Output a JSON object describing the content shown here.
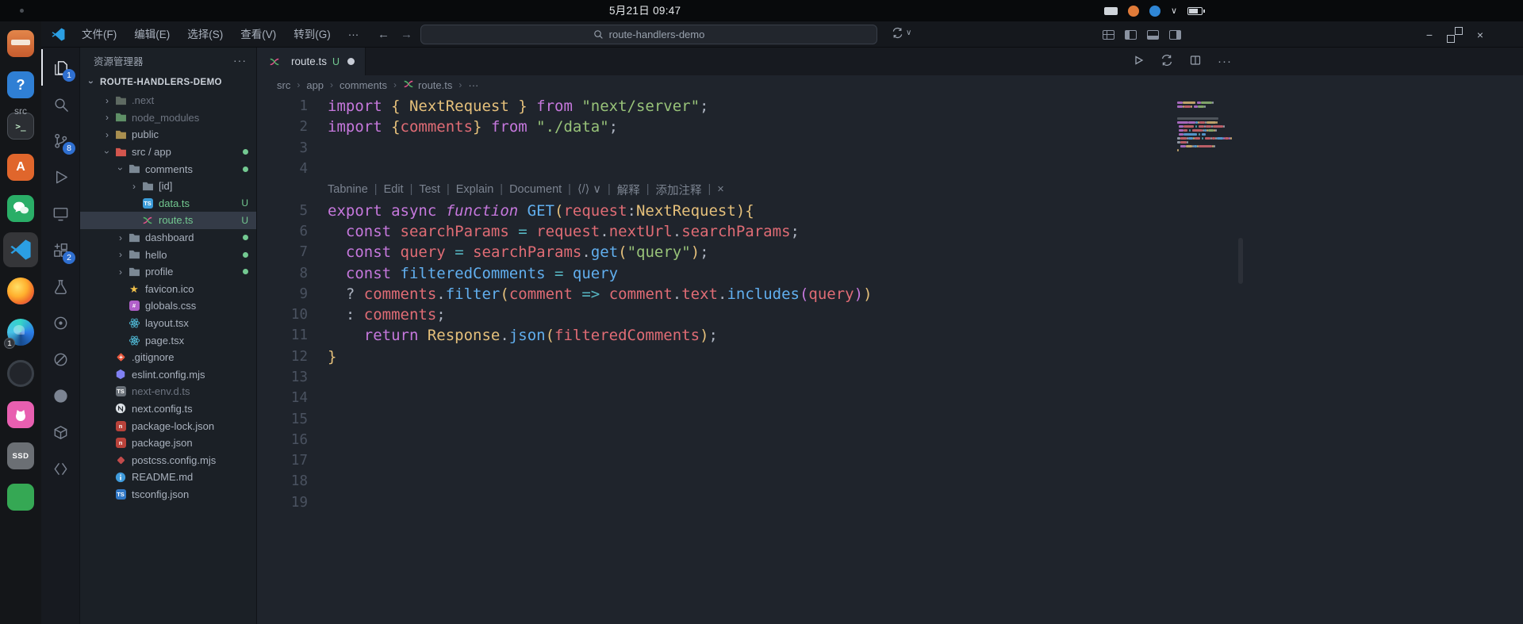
{
  "colors": {
    "tokens": {
      "kw": "#c678dd",
      "kwi": "#c678dd",
      "fn": "#61afef",
      "var": "#e06c75",
      "cls": "#e5c07b",
      "str": "#98c379",
      "op": "#56b6c2",
      "d": "#abb2bf",
      "br2": "#c678dd"
    },
    "accent": "#2f6fd0",
    "git_green": "#73c991"
  },
  "system_bar": {
    "clock": "5月21日 09:47",
    "tray": [
      {
        "name": "keyboard-icon",
        "kind": "keyboard"
      },
      {
        "name": "input-indicator-orange",
        "kind": "orange"
      },
      {
        "name": "app-indicator-blue",
        "kind": "blue"
      },
      {
        "name": "chevron-down-icon",
        "kind": "glyph",
        "glyph": "∨"
      },
      {
        "name": "battery-icon",
        "kind": "battery"
      }
    ]
  },
  "dock": {
    "desktop_label": "src",
    "items": [
      {
        "name": "files-app",
        "icon": "toolbox"
      },
      {
        "name": "help-app",
        "icon": "help",
        "glyph": "?"
      },
      {
        "name": "terminal-app",
        "icon": "terminal",
        "glyph": ">_"
      },
      {
        "name": "app-center",
        "icon": "appcenter",
        "glyph": "A"
      },
      {
        "name": "wechat-app",
        "icon": "wechat"
      },
      {
        "name": "vscode-app",
        "icon": "vscode",
        "active": true
      },
      {
        "name": "firefox-app",
        "icon": "firefox"
      },
      {
        "name": "edge-app",
        "icon": "edge",
        "badge": "1"
      },
      {
        "name": "dark-app",
        "icon": "darkapp"
      },
      {
        "name": "cat-app",
        "icon": "cat"
      },
      {
        "name": "ssd-disk",
        "icon": "ssd",
        "glyph": "SSD"
      },
      {
        "name": "green-app",
        "icon": "green"
      }
    ]
  },
  "titlebar": {
    "menus": [
      "文件(F)",
      "编辑(E)",
      "选择(S)",
      "查看(V)",
      "转到(G)",
      "···"
    ],
    "nav_back": "←",
    "nav_forward": "→",
    "search_value": "route-handlers-demo",
    "layout_icons": [
      {
        "name": "customize-layout-icon",
        "k": "grid"
      },
      {
        "name": "toggle-sidebar-icon",
        "k": "left"
      },
      {
        "name": "toggle-panel-icon",
        "k": "bottom"
      },
      {
        "name": "toggle-secondary-sidebar-icon",
        "k": "right"
      }
    ],
    "window_controls": [
      {
        "name": "minimize-button",
        "glyph": "−"
      },
      {
        "name": "restore-button",
        "kind": "restore"
      },
      {
        "name": "close-button",
        "glyph": "×"
      }
    ]
  },
  "activity_bar": {
    "items": [
      {
        "name": "explorer",
        "icon": "files",
        "badge": "1",
        "active": true
      },
      {
        "name": "search",
        "icon": "search"
      },
      {
        "name": "source-control",
        "icon": "scm",
        "badge": "8"
      },
      {
        "name": "run-and-debug",
        "icon": "debug"
      },
      {
        "name": "remote-explorer",
        "icon": "monitor"
      },
      {
        "name": "extensions",
        "icon": "ext",
        "badge": "2"
      },
      {
        "name": "testing",
        "icon": "beaker"
      },
      {
        "name": "extension-a",
        "icon": "target"
      },
      {
        "name": "extension-b",
        "icon": "circleline"
      },
      {
        "name": "github",
        "icon": "github"
      },
      {
        "name": "package-explorer",
        "icon": "package"
      },
      {
        "name": "snippets",
        "icon": "brackets"
      }
    ]
  },
  "explorer": {
    "title": "资源管理器",
    "more_glyph": "···",
    "root": "ROUTE-HANDLERS-DEMO",
    "items": [
      {
        "label": ".next",
        "d": 0,
        "chev": "right",
        "icon": "folder:#5e6a62",
        "dim": true
      },
      {
        "label": "node_modules",
        "d": 0,
        "chev": "right",
        "icon": "folder:#5e8f66",
        "dim": true
      },
      {
        "label": "public",
        "d": 0,
        "chev": "right",
        "icon": "folder:#a98f4f"
      },
      {
        "label": "src / app",
        "d": 0,
        "chev": "down",
        "icon": "folder:#d4564e",
        "dot": true
      },
      {
        "label": "comments",
        "d": 1,
        "chev": "down",
        "icon": "folder:#7b8894",
        "dot": true
      },
      {
        "label": "[id]",
        "d": 2,
        "chev": "right",
        "icon": "folder:#7b8894"
      },
      {
        "label": "data.ts",
        "d": 2,
        "icon": "ts",
        "git": "U",
        "green": true
      },
      {
        "label": "route.ts",
        "d": 2,
        "icon": "route",
        "git": "U",
        "green": true,
        "selected": true
      },
      {
        "label": "dashboard",
        "d": 1,
        "chev": "right",
        "icon": "folder:#7b8894",
        "dot": true
      },
      {
        "label": "hello",
        "d": 1,
        "chev": "right",
        "icon": "folder:#7b8894",
        "dot": true
      },
      {
        "label": "profile",
        "d": 1,
        "chev": "right",
        "icon": "folder:#7b8894",
        "dot": true
      },
      {
        "label": "favicon.ico",
        "d": 1,
        "icon": "star"
      },
      {
        "label": "globals.css",
        "d": 1,
        "icon": "css"
      },
      {
        "label": "layout.tsx",
        "d": 1,
        "icon": "react"
      },
      {
        "label": "page.tsx",
        "d": 1,
        "icon": "react"
      },
      {
        "label": ".gitignore",
        "d": 0,
        "icon": "git"
      },
      {
        "label": "eslint.config.mjs",
        "d": 0,
        "icon": "eslint"
      },
      {
        "label": "next-env.d.ts",
        "d": 0,
        "icon": "dts",
        "dim": true
      },
      {
        "label": "next.config.ts",
        "d": 0,
        "icon": "next"
      },
      {
        "label": "package-lock.json",
        "d": 0,
        "icon": "npm"
      },
      {
        "label": "package.json",
        "d": 0,
        "icon": "npm"
      },
      {
        "label": "postcss.config.mjs",
        "d": 0,
        "icon": "postcss"
      },
      {
        "label": "README.md",
        "d": 0,
        "icon": "info"
      },
      {
        "label": "tsconfig.json",
        "d": 0,
        "icon": "tsconfig"
      }
    ]
  },
  "editor": {
    "tab": {
      "label": "route.ts",
      "git": "U",
      "modified": true
    },
    "actions": [
      {
        "name": "run-file-button",
        "icon": "play"
      },
      {
        "name": "sync-icon",
        "icon": "sync"
      },
      {
        "name": "split-editor-button",
        "icon": "split"
      },
      {
        "name": "more-actions-button",
        "icon": "dots",
        "glyph": "···"
      }
    ],
    "breadcrumb": [
      {
        "label": "src"
      },
      {
        "label": "app"
      },
      {
        "label": "comments"
      },
      {
        "label": "route.ts",
        "icon": "route"
      },
      {
        "label": "···"
      }
    ],
    "codelens": [
      "Tabnine",
      "Edit",
      "Test",
      "Explain",
      "Document",
      "⟨/⟩ ∨",
      "解释",
      "添加注释",
      "×"
    ],
    "lines": [
      {
        "n": 1,
        "t": [
          [
            "import ",
            "kw"
          ],
          [
            "{ NextRequest }",
            "cls"
          ],
          [
            " ",
            "d"
          ],
          [
            "from ",
            "kw"
          ],
          [
            "\"next/server\"",
            "str"
          ],
          [
            ";",
            "d"
          ]
        ]
      },
      {
        "n": 2,
        "t": [
          [
            "import ",
            "kw"
          ],
          [
            "{",
            "cls"
          ],
          [
            "comments",
            "var"
          ],
          [
            "}",
            "cls"
          ],
          [
            " ",
            "d"
          ],
          [
            "from ",
            "kw"
          ],
          [
            "\"./data\"",
            "str"
          ],
          [
            ";",
            "d"
          ]
        ]
      },
      {
        "n": 3,
        "t": []
      },
      {
        "n": 4,
        "t": []
      },
      {
        "lens": true
      },
      {
        "n": 5,
        "t": [
          [
            "export async ",
            "kw"
          ],
          [
            "function ",
            "kwi"
          ],
          [
            "GET",
            "fn"
          ],
          [
            "(",
            "cls"
          ],
          [
            "request",
            "var"
          ],
          [
            ":",
            "d"
          ],
          [
            "NextRequest",
            "cls"
          ],
          [
            "){",
            "cls"
          ]
        ]
      },
      {
        "n": 6,
        "t": [
          [
            "  ",
            "d"
          ],
          [
            "const ",
            "kw"
          ],
          [
            "searchParams",
            "var"
          ],
          [
            " ",
            "d"
          ],
          [
            "=",
            "op"
          ],
          [
            " ",
            "d"
          ],
          [
            "request",
            "var"
          ],
          [
            ".",
            "d"
          ],
          [
            "nextUrl",
            "var"
          ],
          [
            ".",
            "d"
          ],
          [
            "searchParams",
            "var"
          ],
          [
            ";",
            "d"
          ]
        ]
      },
      {
        "n": 7,
        "t": [
          [
            "  ",
            "d"
          ],
          [
            "const ",
            "kw"
          ],
          [
            "query",
            "var"
          ],
          [
            " ",
            "d"
          ],
          [
            "=",
            "op"
          ],
          [
            " ",
            "d"
          ],
          [
            "searchParams",
            "var"
          ],
          [
            ".",
            "d"
          ],
          [
            "get",
            "fn"
          ],
          [
            "(",
            "cls"
          ],
          [
            "\"query\"",
            "str"
          ],
          [
            ")",
            "cls"
          ],
          [
            ";",
            "d"
          ]
        ]
      },
      {
        "n": 8,
        "t": [
          [
            "  ",
            "d"
          ],
          [
            "const ",
            "kw"
          ],
          [
            "filteredComments",
            "fn"
          ],
          [
            " ",
            "d"
          ],
          [
            "=",
            "op"
          ],
          [
            " ",
            "d"
          ],
          [
            "query",
            "fn"
          ]
        ]
      },
      {
        "n": 9,
        "t": [
          [
            "  ? ",
            "d"
          ],
          [
            "comments",
            "var"
          ],
          [
            ".",
            "d"
          ],
          [
            "filter",
            "fn"
          ],
          [
            "(",
            "cls"
          ],
          [
            "comment",
            "var"
          ],
          [
            " ",
            "d"
          ],
          [
            "=>",
            "op"
          ],
          [
            " ",
            "d"
          ],
          [
            "comment",
            "var"
          ],
          [
            ".",
            "d"
          ],
          [
            "text",
            "var"
          ],
          [
            ".",
            "d"
          ],
          [
            "includes",
            "fn"
          ],
          [
            "(",
            "br2"
          ],
          [
            "query",
            "var"
          ],
          [
            ")",
            "br2"
          ],
          [
            ")",
            "cls"
          ]
        ]
      },
      {
        "n": 10,
        "t": [
          [
            "  : ",
            "d"
          ],
          [
            "comments",
            "var"
          ],
          [
            ";",
            "d"
          ]
        ]
      },
      {
        "n": 11,
        "t": [
          [
            "    ",
            "d"
          ],
          [
            "return ",
            "kw"
          ],
          [
            "Response",
            "cls"
          ],
          [
            ".",
            "d"
          ],
          [
            "json",
            "fn"
          ],
          [
            "(",
            "cls"
          ],
          [
            "filteredComments",
            "var"
          ],
          [
            ")",
            "cls"
          ],
          [
            ";",
            "d"
          ]
        ]
      },
      {
        "n": 12,
        "t": [
          [
            "}",
            "cls"
          ]
        ]
      },
      {
        "n": 13,
        "t": []
      },
      {
        "n": 14,
        "t": []
      },
      {
        "n": 15,
        "t": []
      },
      {
        "n": 16,
        "t": []
      },
      {
        "n": 17,
        "t": []
      },
      {
        "n": 18,
        "t": []
      },
      {
        "n": 19,
        "t": []
      }
    ]
  }
}
